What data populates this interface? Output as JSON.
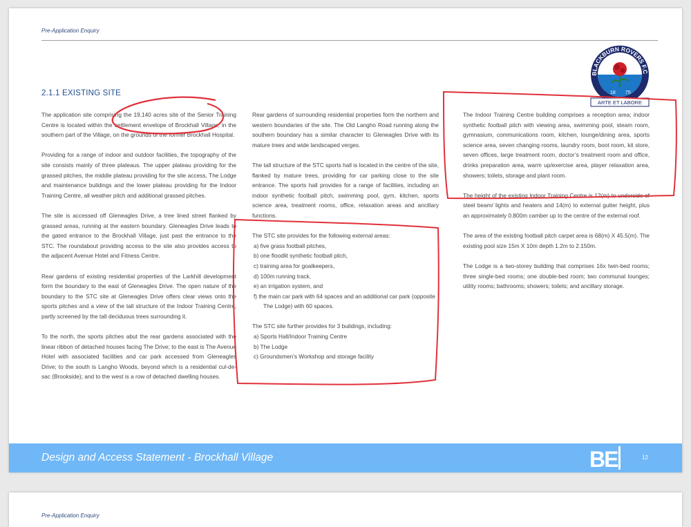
{
  "header": {
    "label": "Pre-Application Enquiry"
  },
  "section": {
    "title": "2.1.1 EXISTING SITE"
  },
  "crest": {
    "top_text": "BLACKBURN ROVERS F.C.",
    "year_left": "18",
    "year_right": "75",
    "motto": "ARTE ET LABORE"
  },
  "col1": {
    "p1": "The application site comprising the 19,140 acres site of the Senior Training Centre is located within the settlement envelope of Brockhall Village, in the southern part of the Village, on the grounds of the former Brockhall Hospital.",
    "p2": "Providing for a range of indoor and outdoor facilities, the topography of the site consists mainly of three plateaus. The upper plateau providing for the grassed pitches, the middle plateau providing for the site access, The Lodge and maintenance buildings and the lower plateau providing for the Indoor Training Centre, all weather pitch and additional grassed pitches.",
    "p3": "The site is accessed off Gleneagles Drive, a tree lined street flanked by grassed areas, running at the eastern boundary. Gleneagles Drive leads to the gated entrance to the Brockhall Village, just past the entrance to the STC. The roundabout providing access to the site also provides access to the adjacent Avenue Hotel and Fitness Centre.",
    "p4": "Rear gardens of existing residential properties of the Larkhill development form the boundary to the east of Gleneagles Drive. The open nature of the boundary to the STC site at Gleneagles Drive offers clear views onto the sports pitches and a view of the tall structure of the Indoor Training Centre, partly screened by the tall deciduous trees surrounding it.",
    "p5": "To the north, the sports pitches abut the rear gardens associated with the linear ribbon of detached houses facing The Drive; to the east is The Avenue Hotel with associated facilities and car park accessed from Gleneagles Drive; to the south is Langho Woods, beyond which is a residential cul-de-sac (Brookside); and to the west is a row of detached dwelling houses."
  },
  "col2": {
    "p1": "Rear gardens of surrounding residential properties form the northern and western boundaries of the site. The Old Langho Road running along the southern boundary has a similar character to Gleneagles Drive with its mature trees and wide landscaped verges.",
    "p2": "The tall structure of the STC sports hall is located in the centre of the site, flanked by mature trees, providing for car parking close to the site entrance. The sports hall provides for a range of facilities, including an indoor synthetic football pitch, swimming pool, gym, kitchen, sports science area, treatment rooms, office, relaxation areas and ancillary functions.",
    "p3": "The STC site provides for the following external areas:",
    "list1": [
      "a) five grass football pitches,",
      "b) one floodlit synthetic football pitch,",
      "c) training area for goalkeepers,",
      "d) 100m running track,",
      "e) an irrigation system, and",
      "f)  the main car park with 64 spaces and an additional car park (opposite The Lodge) with 60 spaces."
    ],
    "p4": "The STC site further provides for 3 buildings, including:",
    "list2": [
      "a) Sports Hall/Indoor Training Centre",
      "b) The Lodge",
      "c) Groundsmen’s Workshop and storage facility"
    ]
  },
  "col3": {
    "p1": "The Indoor Training Centre building comprises a reception area; indoor synthetic football pitch with viewing area, swimming pool, steam room, gymnasium, communications room, kitchen, lounge/dining area, sports science area, seven changing rooms, laundry room, boot room, kit store, seven offices, large treatment room, doctor’s treatment room and office, drinks preparation area, warm up/exercise area, player relaxation area, showers; toilets, storage and plant room.",
    "p2": "The height of the existing Indoor Training Centre is 12(m) to underside of steel beam/ lights and heaters and 14(m) to external gutter height, plus an approximately 0.800m camber up to the centre of the external roof.",
    "p3": "The area of the existing football pitch carpet area is 68(m) X 45.5(m). The existing pool size 15m X 10m depth 1.2m to 2.150m.",
    "p4": "The Lodge is a two-storey building that comprises 16x twin-bed rooms; three single-bed rooms; one double-bed room; two communal lounges; utility rooms; bathrooms; showers; toilets; and ancillary storage."
  },
  "footer": {
    "title": "Design and Access Statement  - Brockhall Village",
    "logo_text": "BE",
    "page_number": "12"
  },
  "page2": {
    "header_label": "Pre-Application Enquiry"
  },
  "colors": {
    "footer_band": "#6fb7f7",
    "title_blue": "#1f4f8f",
    "annotation_red": "#e0303a"
  }
}
